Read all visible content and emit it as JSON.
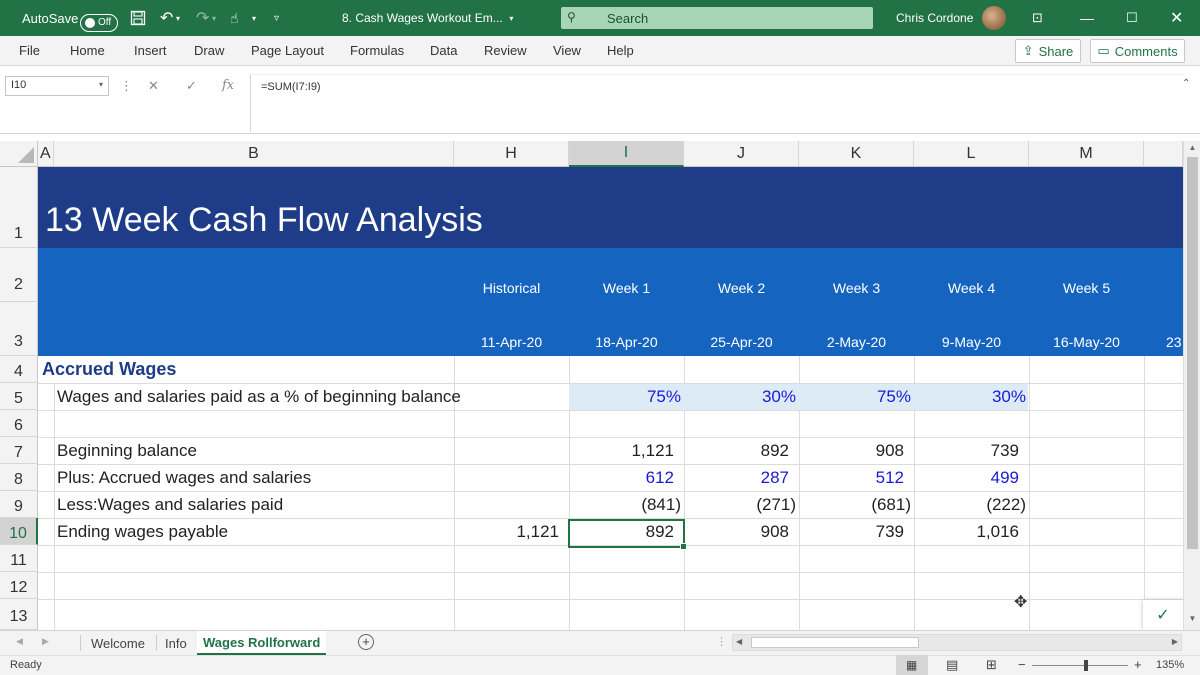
{
  "titlebar": {
    "autosave_label": "AutoSave",
    "autosave_state": "Off",
    "document_title": "8. Cash Wages Workout Em...",
    "search_placeholder": "Search",
    "user_name": "Chris Cordone",
    "bg_color": "#217346"
  },
  "ribbon": {
    "tabs": [
      "File",
      "Home",
      "Insert",
      "Draw",
      "Page Layout",
      "Formulas",
      "Data",
      "Review",
      "View",
      "Help"
    ],
    "share_label": "Share",
    "comments_label": "Comments"
  },
  "formula_bar": {
    "name_box": "I10",
    "formula": "=SUM(I7:I9)"
  },
  "columns": [
    "A",
    "B",
    "H",
    "I",
    "J",
    "K",
    "L",
    "M"
  ],
  "rows": [
    "1",
    "2",
    "3",
    "4",
    "5",
    "6",
    "7",
    "8",
    "9",
    "10",
    "11",
    "12",
    "13"
  ],
  "sheet": {
    "title": "13 Week Cash Flow Analysis",
    "period_headers": [
      "Historical",
      "Week 1",
      "Week 2",
      "Week 3",
      "Week 4",
      "Week 5"
    ],
    "dates": [
      "11-Apr-20",
      "18-Apr-20",
      "25-Apr-20",
      "2-May-20",
      "9-May-20",
      "16-May-20"
    ],
    "overflow_date_fragment": "23",
    "section_label": "Accrued Wages",
    "pct_row": {
      "label": "Wages and salaries paid as a % of beginning balance",
      "values": [
        "75%",
        "30%",
        "75%",
        "30%"
      ]
    },
    "beginning_balance": {
      "label": "Beginning balance",
      "values": [
        "1,121",
        "892",
        "908",
        "739"
      ]
    },
    "accrued": {
      "label": "Plus: Accrued wages and salaries",
      "values": [
        "612",
        "287",
        "512",
        "499"
      ]
    },
    "paid": {
      "label": "Less:Wages and salaries paid",
      "values": [
        "(841)",
        "(271)",
        "(681)",
        "(222)"
      ]
    },
    "ending": {
      "label": "Ending wages payable",
      "historical": "1,121",
      "values": [
        "892",
        "908",
        "739",
        "1,016"
      ]
    }
  },
  "sheet_tabs": [
    "Welcome",
    "Info",
    "Wages Rollforward"
  ],
  "active_sheet": "Wages Rollforward",
  "status": {
    "ready": "Ready",
    "zoom": "135%"
  },
  "colors": {
    "excel_green": "#217346",
    "title_band": "#1f3c88",
    "header_band": "#1565c0",
    "input_blue": "#1a1ad6",
    "pct_fill": "#ddebf7"
  }
}
